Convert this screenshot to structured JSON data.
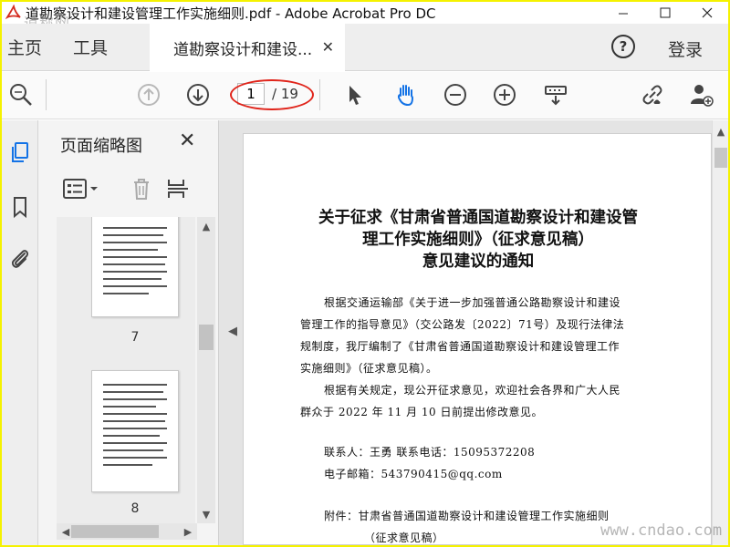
{
  "window": {
    "title": "道勘察设计和建设管理工作实施细则.pdf - Adobe Acrobat Pro DC",
    "watermark_top": "道称网",
    "watermark_bottom": "www.cndao.com"
  },
  "menu": {
    "home": "主页",
    "tools": "工具",
    "doc_tab": "道勘察设计和建设...",
    "help": "?",
    "sign_in": "登录"
  },
  "toolbar": {
    "current_page": "1",
    "total_pages": "/ 19",
    "highlight_color": "#e0251b"
  },
  "thumb_panel": {
    "title": "页面缩略图",
    "pages": [
      {
        "number": "7"
      },
      {
        "number": "8"
      }
    ]
  },
  "document": {
    "title_line1": "关于征求《甘肃省普通国道勘察设计和建设管",
    "title_line2": "理工作实施细则》（征求意见稿）",
    "title_line3": "意见建议的通知",
    "para1": "根据交通运输部《关于进一步加强普通公路勘察设计和建设管理工作的指导意见》（交公路发〔2022〕71号）及现行法律法规制度，我厅编制了《甘肃省普通国道勘察设计和建设管理工作实施细则》（征求意见稿）。",
    "para1_lines": [
      "根据交通运输部《关于进一步加强普通公路勘察设计和建设",
      "管理工作的指导意见》（交公路发〔2022〕71号）及现行法律法",
      "规制度，我厅编制了《甘肃省普通国道勘察设计和建设管理工作",
      "实施细则》（征求意见稿）。"
    ],
    "para2_lines": [
      "根据有关规定，现公开征求意见，欢迎社会各界和广大人民",
      "群众于 2022 年 11 月 10 日前提出修改意见。"
    ],
    "contact": "联系人：王勇    联系电话：15095372208",
    "email": "电子邮箱：543790415@qq.com",
    "attachment_line1": "附件：甘肃省普通国道勘察设计和建设管理工作实施细则",
    "attachment_line2": "（征求意见稿）"
  }
}
